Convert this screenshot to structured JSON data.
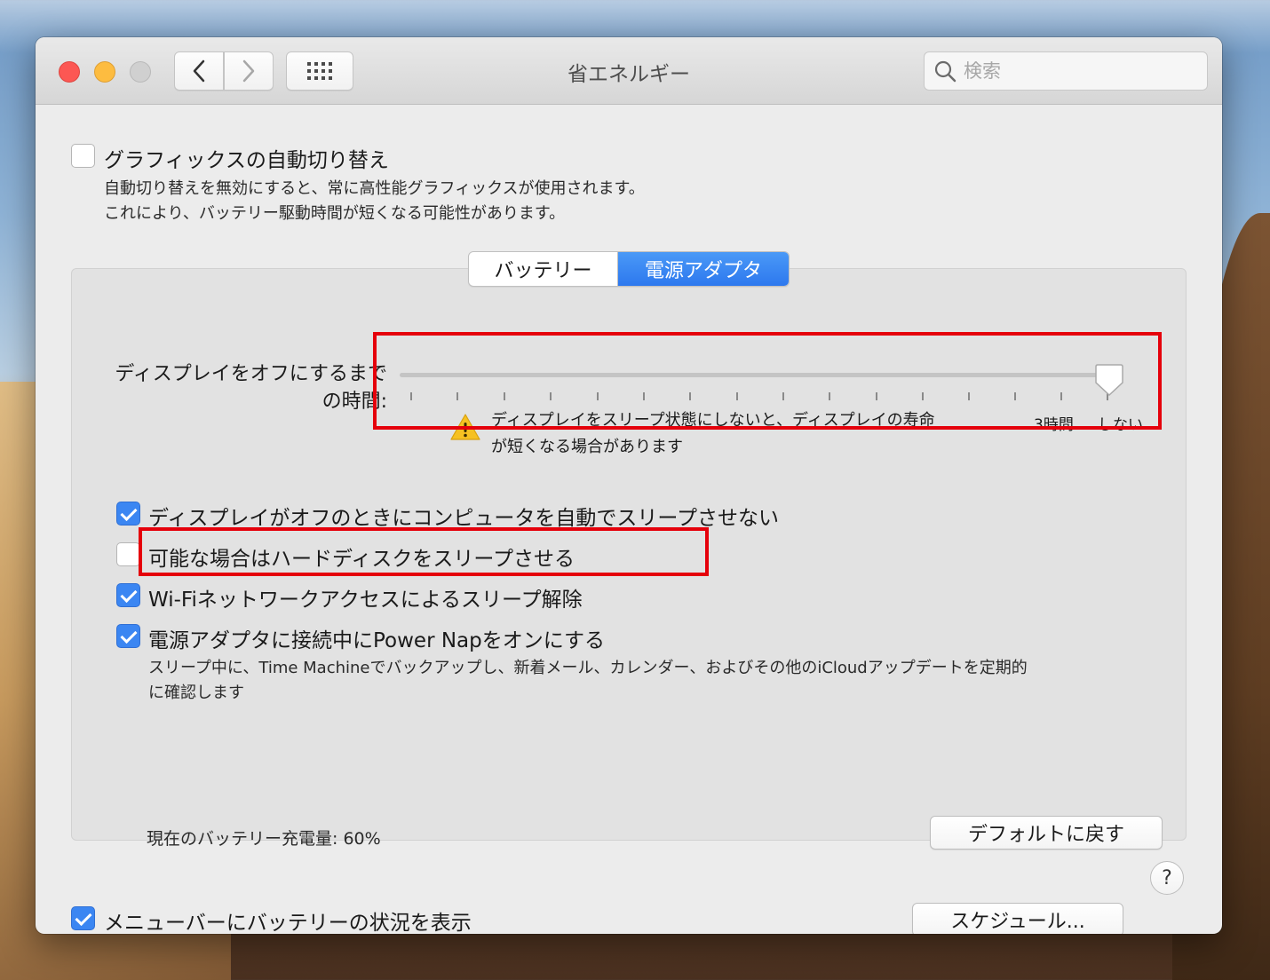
{
  "window": {
    "title": "省エネルギー",
    "search_placeholder": "検索"
  },
  "graphics_switching": {
    "checked": false,
    "label": "グラフィックスの自動切り替え",
    "desc_line1": "自動切り替えを無効にすると、常に高性能グラフィックスが使用されます。",
    "desc_line2": "これにより、バッテリー駆動時間が短くなる可能性があります。"
  },
  "tabs": [
    {
      "label": "バッテリー",
      "selected": false
    },
    {
      "label": "電源アダプタ",
      "selected": true
    }
  ],
  "display_sleep": {
    "label_line1": "ディスプレイをオフにするまで",
    "label_line2": "の時間:",
    "value": "しない",
    "tick_labels": [
      "3時間",
      "しない"
    ],
    "warning_line1": "ディスプレイをスリープ状態にしないと、ディスプレイの寿命",
    "warning_line2": "が短くなる場合があります"
  },
  "options": [
    {
      "checked": true,
      "label": "ディスプレイがオフのときにコンピュータを自動でスリープさせない"
    },
    {
      "checked": false,
      "label": "可能な場合はハードディスクをスリープさせる"
    },
    {
      "checked": true,
      "label": "Wi-Fiネットワークアクセスによるスリープ解除"
    },
    {
      "checked": true,
      "label": "電源アダプタに接続中にPower Napをオンにする"
    }
  ],
  "power_nap_desc_line1": "スリープ中に、Time Machineでバックアップし、新着メール、カレンダー、およびその他のiCloudアップデートを定期的",
  "power_nap_desc_line2": "に確認します",
  "battery_status": "現在のバッテリー充電量: 60%",
  "buttons": {
    "restore_defaults": "デフォルトに戻す",
    "schedule": "スケジュール...",
    "help": "?"
  },
  "show_in_menubar": {
    "checked": true,
    "label": "メニューバーにバッテリーの状況を表示"
  },
  "colors": {
    "accent": "#3b86f2",
    "annotation_red": "#e5000b"
  }
}
